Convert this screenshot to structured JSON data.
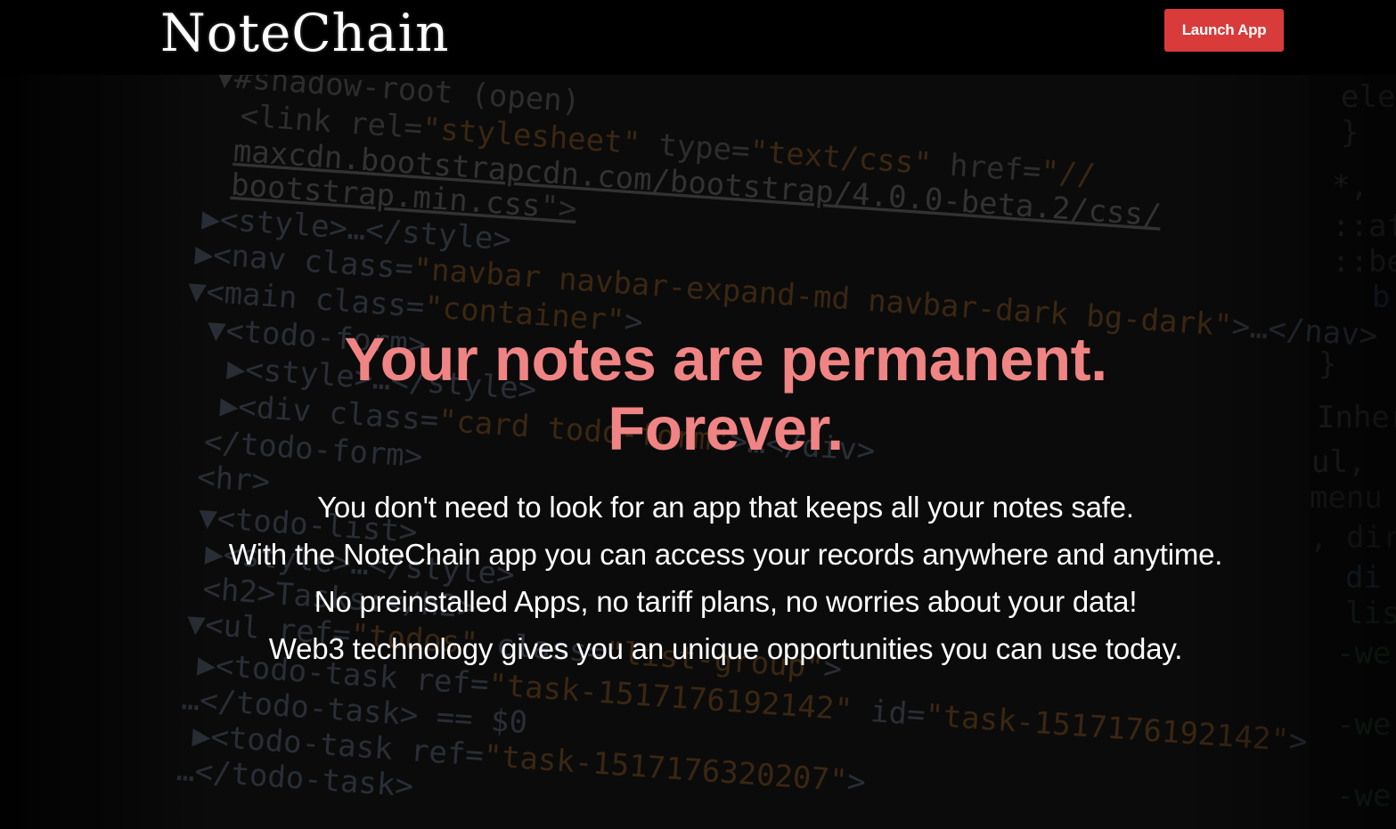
{
  "header": {
    "logo_text": "NoteChain",
    "launch_label": "Launch App"
  },
  "hero": {
    "headline_line1": "Your notes are permanent.",
    "headline_line2": "Forever.",
    "lines": [
      "You don't need to look for an app that keeps all your notes safe.",
      "With the NoteChain app you can access your records anywhere and anytime.",
      "No preinstalled Apps, no tariff plans, no worries about your data!",
      "Web3 technology gives you an unique opportunities you can use today."
    ]
  },
  "colors": {
    "accent": "#d93a3a",
    "headline": "#f08484",
    "background": "#000000"
  }
}
